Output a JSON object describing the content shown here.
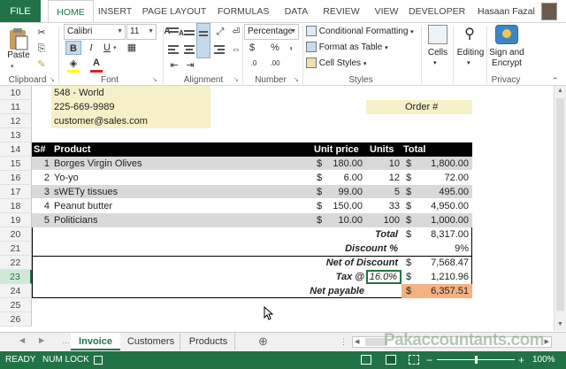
{
  "ribbon_tabs": [
    "FILE",
    "HOME",
    "INSERT",
    "PAGE LAYOUT",
    "FORMULAS",
    "DATA",
    "REVIEW",
    "VIEW",
    "DEVELOPER"
  ],
  "user_name": "Hasaan Fazal",
  "ribbon": {
    "paste_label": "Paste",
    "font_name": "Calibri",
    "font_size": "11",
    "number_format": "Percentage",
    "conditional_formatting": "Conditional Formatting",
    "format_as_table": "Format as Table",
    "cell_styles": "Cell Styles",
    "cells_label": "Cells",
    "editing_label": "Editing",
    "sign_encrypt_label": "Sign and Encrypt",
    "groups": {
      "clipboard": "Clipboard",
      "font": "Font",
      "alignment": "Alignment",
      "number": "Number",
      "styles": "Styles",
      "privacy": "Privacy"
    },
    "font_buttons": {
      "bold": "B",
      "italic": "I",
      "underline": "U",
      "font_color": "A",
      "grow": "A",
      "shrink": "A"
    },
    "number_buttons": {
      "currency": "$",
      "percent": "%",
      "comma": ",",
      "inc": ".0",
      "dec": ".00"
    }
  },
  "row_numbers": [
    "10",
    "11",
    "12",
    "13",
    "14",
    "15",
    "16",
    "17",
    "18",
    "19",
    "20",
    "21",
    "22",
    "23",
    "24",
    "25",
    "26"
  ],
  "address": [
    "548 - World",
    "225-669-9989",
    "customer@sales.com"
  ],
  "order_label": "Order #",
  "table": {
    "headers": {
      "sn": "S#",
      "product": "Product",
      "unit_price": "Unit price",
      "units": "Units",
      "total": "Total"
    },
    "rows": [
      {
        "sn": "1",
        "product": "Borges Virgin Olives",
        "cur1": "$",
        "price": "180.00",
        "units": "10",
        "cur2": "$",
        "total": "1,800.00"
      },
      {
        "sn": "2",
        "product": "Yo-yo",
        "cur1": "$",
        "price": "6.00",
        "units": "12",
        "cur2": "$",
        "total": "72.00"
      },
      {
        "sn": "3",
        "product": "sWETy tissues",
        "cur1": "$",
        "price": "99.00",
        "units": "5",
        "cur2": "$",
        "total": "495.00"
      },
      {
        "sn": "4",
        "product": "Peanut butter",
        "cur1": "$",
        "price": "150.00",
        "units": "33",
        "cur2": "$",
        "total": "4,950.00"
      },
      {
        "sn": "5",
        "product": "Politicians",
        "cur1": "$",
        "price": "10.00",
        "units": "100",
        "cur2": "$",
        "total": "1,000.00"
      }
    ]
  },
  "summary": {
    "total_label": "Total",
    "total_cur": "$",
    "total_value": "8,317.00",
    "discount_label": "Discount %",
    "discount_value": "9%",
    "net_discount_label": "Net of Discount",
    "net_discount_cur": "$",
    "net_discount_value": "7,568.47",
    "tax_label": "Tax @",
    "tax_rate": "16.0%",
    "tax_cur": "$",
    "tax_value": "1,210.96",
    "net_payable_label": "Net payable",
    "net_payable_cur": "$",
    "net_payable_value": "6,357.51"
  },
  "sheets": [
    "Invoice",
    "Customers",
    "Products"
  ],
  "add_sheet": "⊕",
  "watermark": "Pakaccountants.com",
  "status": {
    "ready": "READY",
    "numlock": "NUM LOCK",
    "zoom": "100%"
  },
  "colors": {
    "excel_green": "#217346",
    "header_black": "#000000",
    "cream": "#f6f0c8",
    "grey_row": "#d9d9d9",
    "orange": "#f4b183"
  }
}
